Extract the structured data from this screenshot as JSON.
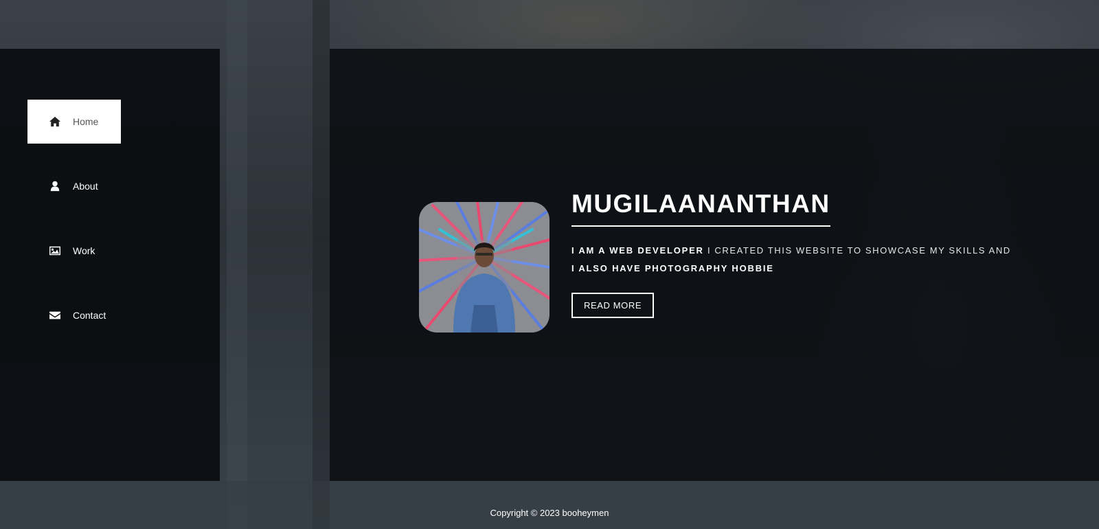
{
  "nav": {
    "items": [
      {
        "label": "Home",
        "icon": "home-icon",
        "active": true
      },
      {
        "label": "About",
        "icon": "user-icon",
        "active": false
      },
      {
        "label": "Work",
        "icon": "image-icon",
        "active": false
      },
      {
        "label": "Contact",
        "icon": "envelope-icon",
        "active": false
      }
    ]
  },
  "hero": {
    "name": "MUGILAANANTHAN",
    "tagline": {
      "part1_bold": "I AM A WEB DEVELOPER",
      "part2": " I CREATED THIS WEBSITE TO SHOWCASE MY SKILLS AND ",
      "part3_bold": "I ALSO HAVE PHOTOGRAPHY HOBBIE"
    },
    "button_label": "READ MORE"
  },
  "footer": {
    "copyright": "Copyright © 2023 booheymen"
  },
  "colors": {
    "panel_bg": "#0a0d10",
    "active_nav_bg": "#ffffff",
    "text": "#ffffff"
  }
}
